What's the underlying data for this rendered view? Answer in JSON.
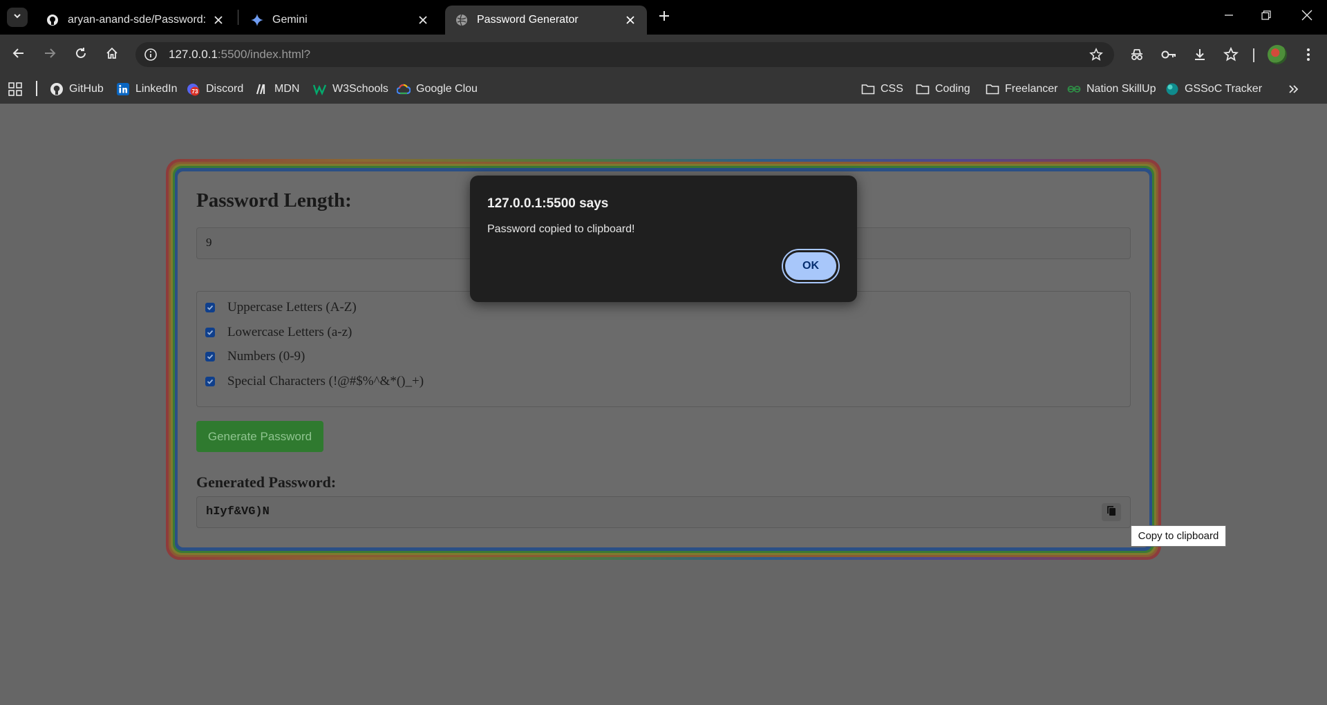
{
  "browser": {
    "tabs": [
      {
        "title": "aryan-anand-sde/Password: Thi",
        "icon": "github-icon",
        "active": false
      },
      {
        "title": "Gemini",
        "icon": "gemini-icon",
        "active": false
      },
      {
        "title": "Password Generator",
        "icon": "globe-icon",
        "active": true
      }
    ],
    "address": {
      "host": "127.0.0.1",
      "rest": ":5500/index.html?"
    },
    "bookmarks": [
      {
        "label": "GitHub",
        "icon": "github-icon"
      },
      {
        "label": "LinkedIn",
        "icon": "linkedin-icon"
      },
      {
        "label": "Discord",
        "icon": "discord-icon",
        "badge": "73"
      },
      {
        "label": "MDN",
        "icon": "mdn-icon"
      },
      {
        "label": "W3Schools",
        "icon": "w3schools-icon"
      },
      {
        "label": "Google Clou",
        "icon": "google-cloud-icon"
      },
      {
        "label": "CSS",
        "icon": "folder-icon"
      },
      {
        "label": "Coding",
        "icon": "folder-icon"
      },
      {
        "label": "Freelancer",
        "icon": "folder-icon"
      },
      {
        "label": "Nation SkillUp",
        "icon": "geeks-icon"
      },
      {
        "label": "GSSoC Tracker",
        "icon": "globe-icon"
      }
    ]
  },
  "page": {
    "length_title": "Password Length:",
    "length_value": "9",
    "options": [
      {
        "label": "Uppercase Letters (A-Z)",
        "checked": true
      },
      {
        "label": "Lowercase Letters (a-z)",
        "checked": true
      },
      {
        "label": "Numbers (0-9)",
        "checked": true
      },
      {
        "label": "Special Characters (!@#$%^&*()_+)",
        "checked": true
      }
    ],
    "generate_label": "Generate Password",
    "generated_title": "Generated Password:",
    "generated_value": "hIyf&VG)N",
    "copy_tooltip": "Copy to clipboard"
  },
  "dialog": {
    "title": "127.0.0.1:5500 says",
    "message": "Password copied to clipboard!",
    "ok_label": "OK"
  },
  "colors": {
    "accent_button": "#a8c7fa",
    "generate_button": "#2f7a2f",
    "checkbox": "#0f3f8c"
  }
}
